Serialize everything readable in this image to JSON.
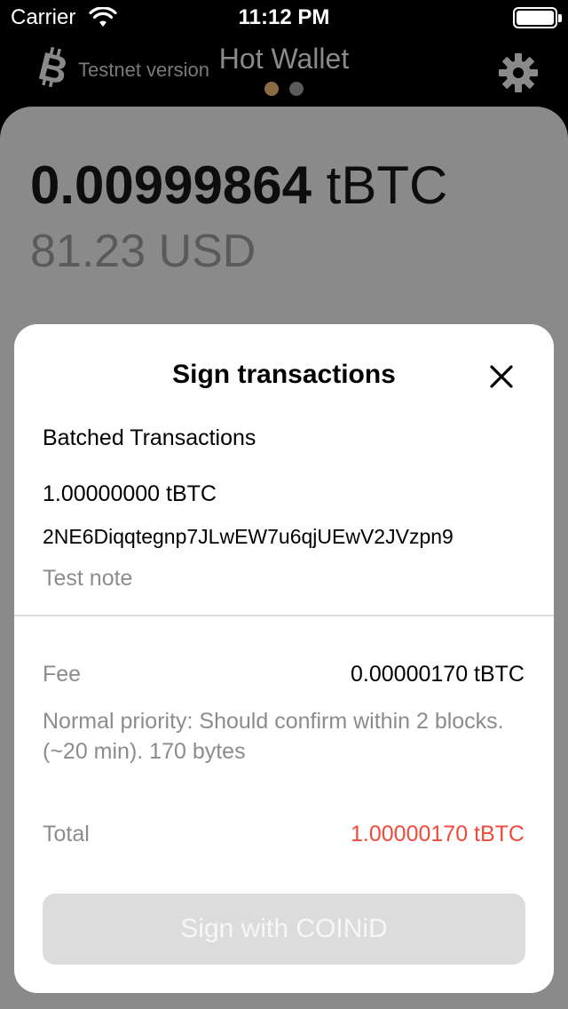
{
  "status_bar": {
    "carrier": "Carrier",
    "time": "11:12 PM"
  },
  "header": {
    "testnet_label": "Testnet version",
    "title": "Hot Wallet",
    "page_dots": {
      "count": 2,
      "active_index": 0,
      "active_color": "#8b6b43",
      "inactive_color": "#5a5a5a"
    },
    "icons": {
      "logo": "bitcoin-logo-icon",
      "settings": "gear-icon"
    }
  },
  "wallet": {
    "balance_amount": "0.00999864",
    "balance_unit": "tBTC",
    "fiat": "81.23 USD"
  },
  "modal": {
    "title": "Sign transactions",
    "close_icon": "close-icon",
    "section_title": "Batched Transactions",
    "transaction": {
      "amount": "1.00000000 tBTC",
      "address": "2NE6Diqqtegnp7JLwEW7u6qjUEwV2JVzpn9",
      "note": "Test note"
    },
    "fee": {
      "label": "Fee",
      "value": "0.00000170 tBTC",
      "description": "Normal priority: Should confirm within 2 blocks. (~20 min). 170 bytes"
    },
    "total": {
      "label": "Total",
      "value": "1.00000170 tBTC"
    },
    "sign_button": "Sign with COINiD"
  },
  "colors": {
    "accent_total": "#f04a3c",
    "overlay": "#8a8a8a",
    "button_disabled": "#dcdcdc"
  }
}
